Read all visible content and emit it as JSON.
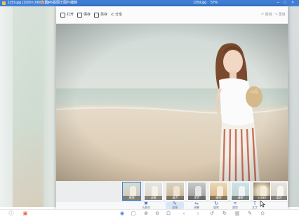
{
  "title_bar": {
    "file_name": "1259.jpg  (1920×1080像素)",
    "doc_label": "2345看图王图片编辑",
    "center_name": "1259.jpg",
    "zoom": "57%"
  },
  "editor": {
    "toolbar_left": [
      {
        "label": "打开",
        "icon": "folder-icon"
      },
      {
        "label": "保存",
        "icon": "save-icon"
      },
      {
        "label": "另存",
        "icon": "save-as-icon"
      },
      {
        "label": "分享",
        "icon": "share-icon"
      }
    ],
    "toolbar_right": [
      {
        "label": "撤销",
        "icon": "undo-icon"
      },
      {
        "label": "重做",
        "icon": "redo-icon"
      }
    ],
    "filters": [
      {
        "label": "原图"
      },
      {
        "label": "淡雅"
      },
      {
        "label": "复古"
      },
      {
        "label": "黑白"
      },
      {
        "label": "暖阳"
      },
      {
        "label": "清新"
      },
      {
        "label": "LOMO"
      },
      {
        "label": "柔光"
      }
    ],
    "tools": [
      {
        "label": "马赛克",
        "icon": "mosaic-icon",
        "glyph": "✖"
      },
      {
        "label": "滤镜",
        "icon": "filter-icon",
        "glyph": "✎"
      },
      {
        "label": "调整",
        "icon": "adjust-icon",
        "glyph": "⇋"
      },
      {
        "label": "旋转",
        "icon": "rotate-icon",
        "glyph": "↻"
      },
      {
        "label": "裁剪",
        "icon": "crop-icon",
        "glyph": "⌗"
      },
      {
        "label": "文字",
        "icon": "text-icon",
        "glyph": "T"
      }
    ]
  },
  "colors": {
    "title_bar": "#3f7fd6",
    "accent": "#3d6fc4"
  }
}
